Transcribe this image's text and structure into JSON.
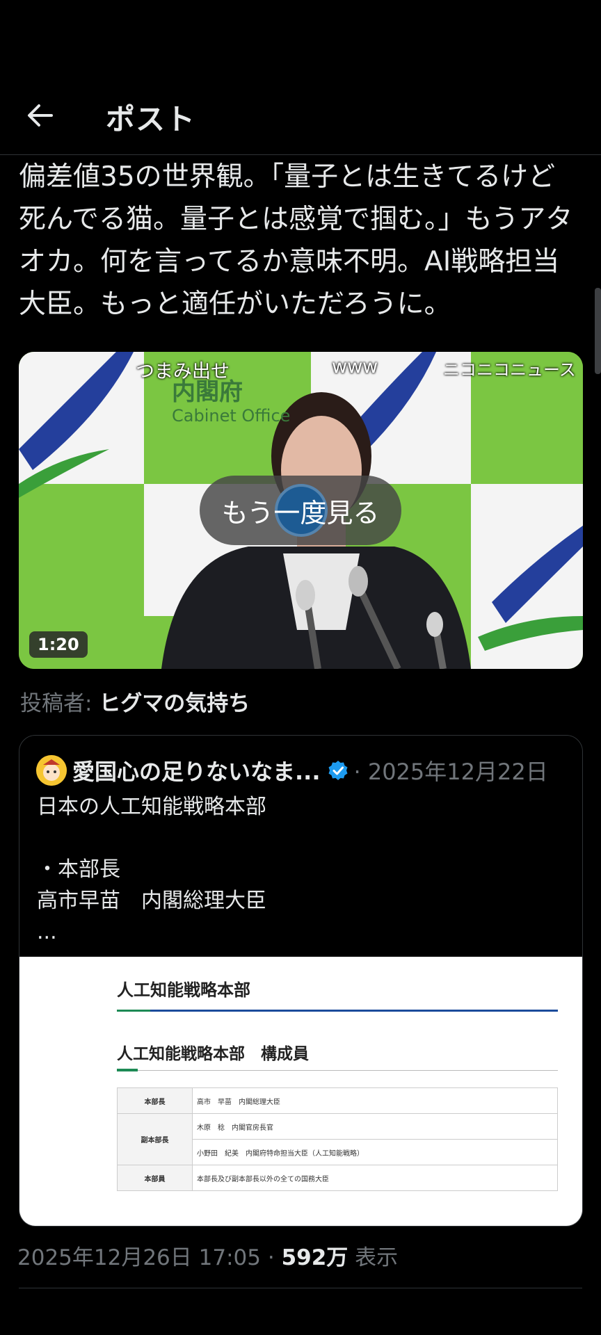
{
  "header": {
    "title": "ポスト"
  },
  "post": {
    "text": "偏差値35の世界観。「量子とは生きてるけど死んでる猫。量子とは感覚で掴む。」もうアタオカ。何を言ってるか意味不明。AI戦略担当大臣。もっと適任がいただろうに。",
    "video": {
      "overlay_texts": [
        "つまみ出せ",
        "www",
        "ニコニコニュース"
      ],
      "replay_label": "もう一度見る",
      "duration": "1:20",
      "background_texts": {
        "kanji": "内閣府",
        "english": "Cabinet Office"
      }
    },
    "poster_label": "投稿者:",
    "poster_name": "ヒグマの気持ち",
    "timestamp": "2025年12月26日 17:05",
    "separator": "·",
    "views_count": "592万",
    "views_label": "表示"
  },
  "quote": {
    "name": "愛国心の足りないなま...",
    "date": "· 2025年12月22日",
    "text": "日本の人工知能戦略本部\n\n・本部長\n高市早苗　内閣総理大臣\n...",
    "image": {
      "title": "人工知能戦略本部",
      "subtitle": "人工知能戦略本部　構成員",
      "rows": [
        {
          "role": "本部長",
          "member": "高市　早苗　内閣総理大臣"
        },
        {
          "role": "副本部長",
          "member": "木原　稔　内閣官房長官"
        },
        {
          "role": "",
          "member": "小野田　紀美　内閣府特命担当大臣（人工知能戦略）"
        },
        {
          "role": "本部員",
          "member": "本部長及び副本部長以外の全ての国務大臣"
        }
      ]
    }
  },
  "colors": {
    "background": "#000000",
    "text": "#e7e9ea",
    "muted": "#71767b",
    "verified": "#1d9bf0",
    "video_green": "#7bc642"
  }
}
